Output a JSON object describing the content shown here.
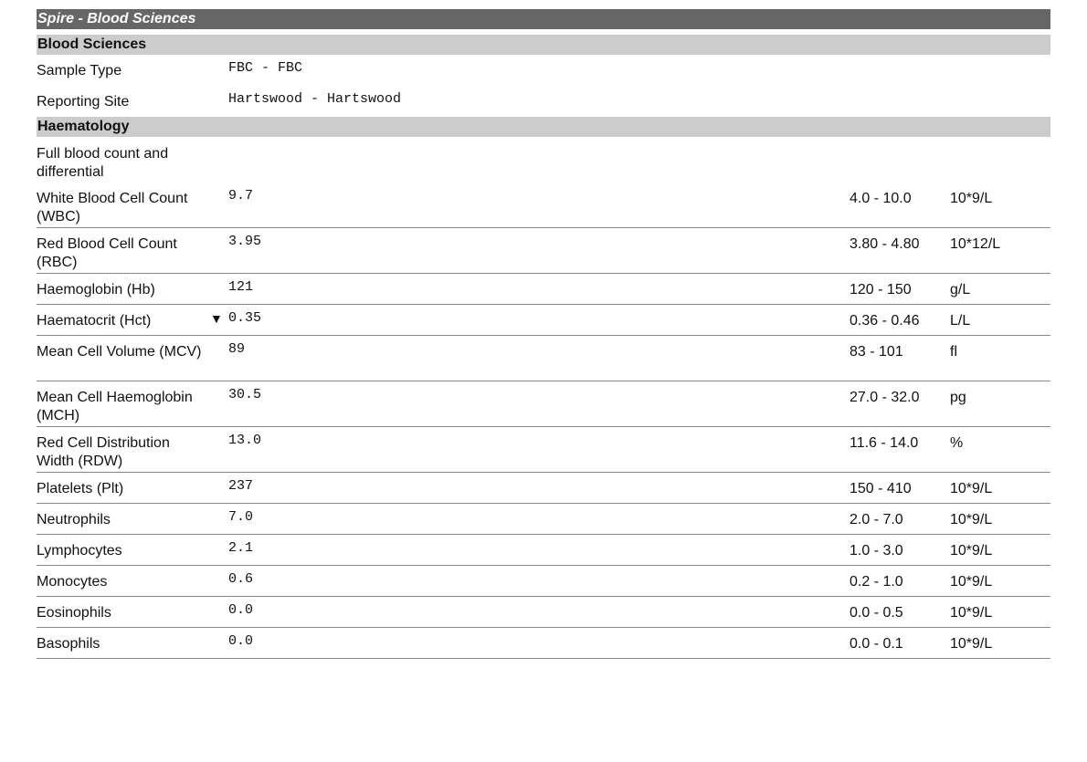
{
  "title": "Spire - Blood Sciences",
  "sections": {
    "blood_sciences": {
      "heading": "Blood Sciences",
      "sample_type_label": "Sample Type",
      "sample_type_value": "FBC - FBC",
      "reporting_site_label": "Reporting Site",
      "reporting_site_value": "Hartswood - Hartswood"
    },
    "haematology": {
      "heading": "Haematology",
      "panel_name": "Full blood count and differential"
    }
  },
  "flags": {
    "low": "▼"
  },
  "results": [
    {
      "name": "White Blood Cell Count (WBC)",
      "flag": "",
      "value": "9.7",
      "range": "4.0 - 10.0",
      "unit": "10*9/L"
    },
    {
      "name": "Red Blood Cell Count (RBC)",
      "flag": "",
      "value": "3.95",
      "range": "3.80 - 4.80",
      "unit": "10*12/L"
    },
    {
      "name": "Haemoglobin (Hb)",
      "flag": "",
      "value": "121",
      "range": "120 - 150",
      "unit": "g/L"
    },
    {
      "name": "Haematocrit (Hct)",
      "flag": "▼",
      "value": "0.35",
      "range": "0.36 - 0.46",
      "unit": "L/L"
    },
    {
      "name": "Mean Cell Volume (MCV)",
      "flag": "",
      "value": "89",
      "range": "83 - 101",
      "unit": "fl"
    },
    {
      "name": "Mean Cell Haemoglobin (MCH)",
      "flag": "",
      "value": "30.5",
      "range": "27.0 - 32.0",
      "unit": "pg"
    },
    {
      "name": "Red Cell Distribution Width (RDW)",
      "flag": "",
      "value": "13.0",
      "range": "11.6 - 14.0",
      "unit": "%"
    },
    {
      "name": "Platelets (Plt)",
      "flag": "",
      "value": "237",
      "range": "150 - 410",
      "unit": "10*9/L"
    },
    {
      "name": "Neutrophils",
      "flag": "",
      "value": "7.0",
      "range": "2.0 - 7.0",
      "unit": "10*9/L"
    },
    {
      "name": "Lymphocytes",
      "flag": "",
      "value": "2.1",
      "range": "1.0 - 3.0",
      "unit": "10*9/L"
    },
    {
      "name": "Monocytes",
      "flag": "",
      "value": "0.6",
      "range": "0.2 - 1.0",
      "unit": "10*9/L"
    },
    {
      "name": "Eosinophils",
      "flag": "",
      "value": "0.0",
      "range": "0.0 - 0.5",
      "unit": "10*9/L"
    },
    {
      "name": "Basophils",
      "flag": "",
      "value": "0.0",
      "range": "0.0 - 0.1",
      "unit": "10*9/L"
    }
  ],
  "colors": {
    "title_bar": "#666666",
    "section_bar": "#cccccc",
    "row_divider": "#888888"
  }
}
